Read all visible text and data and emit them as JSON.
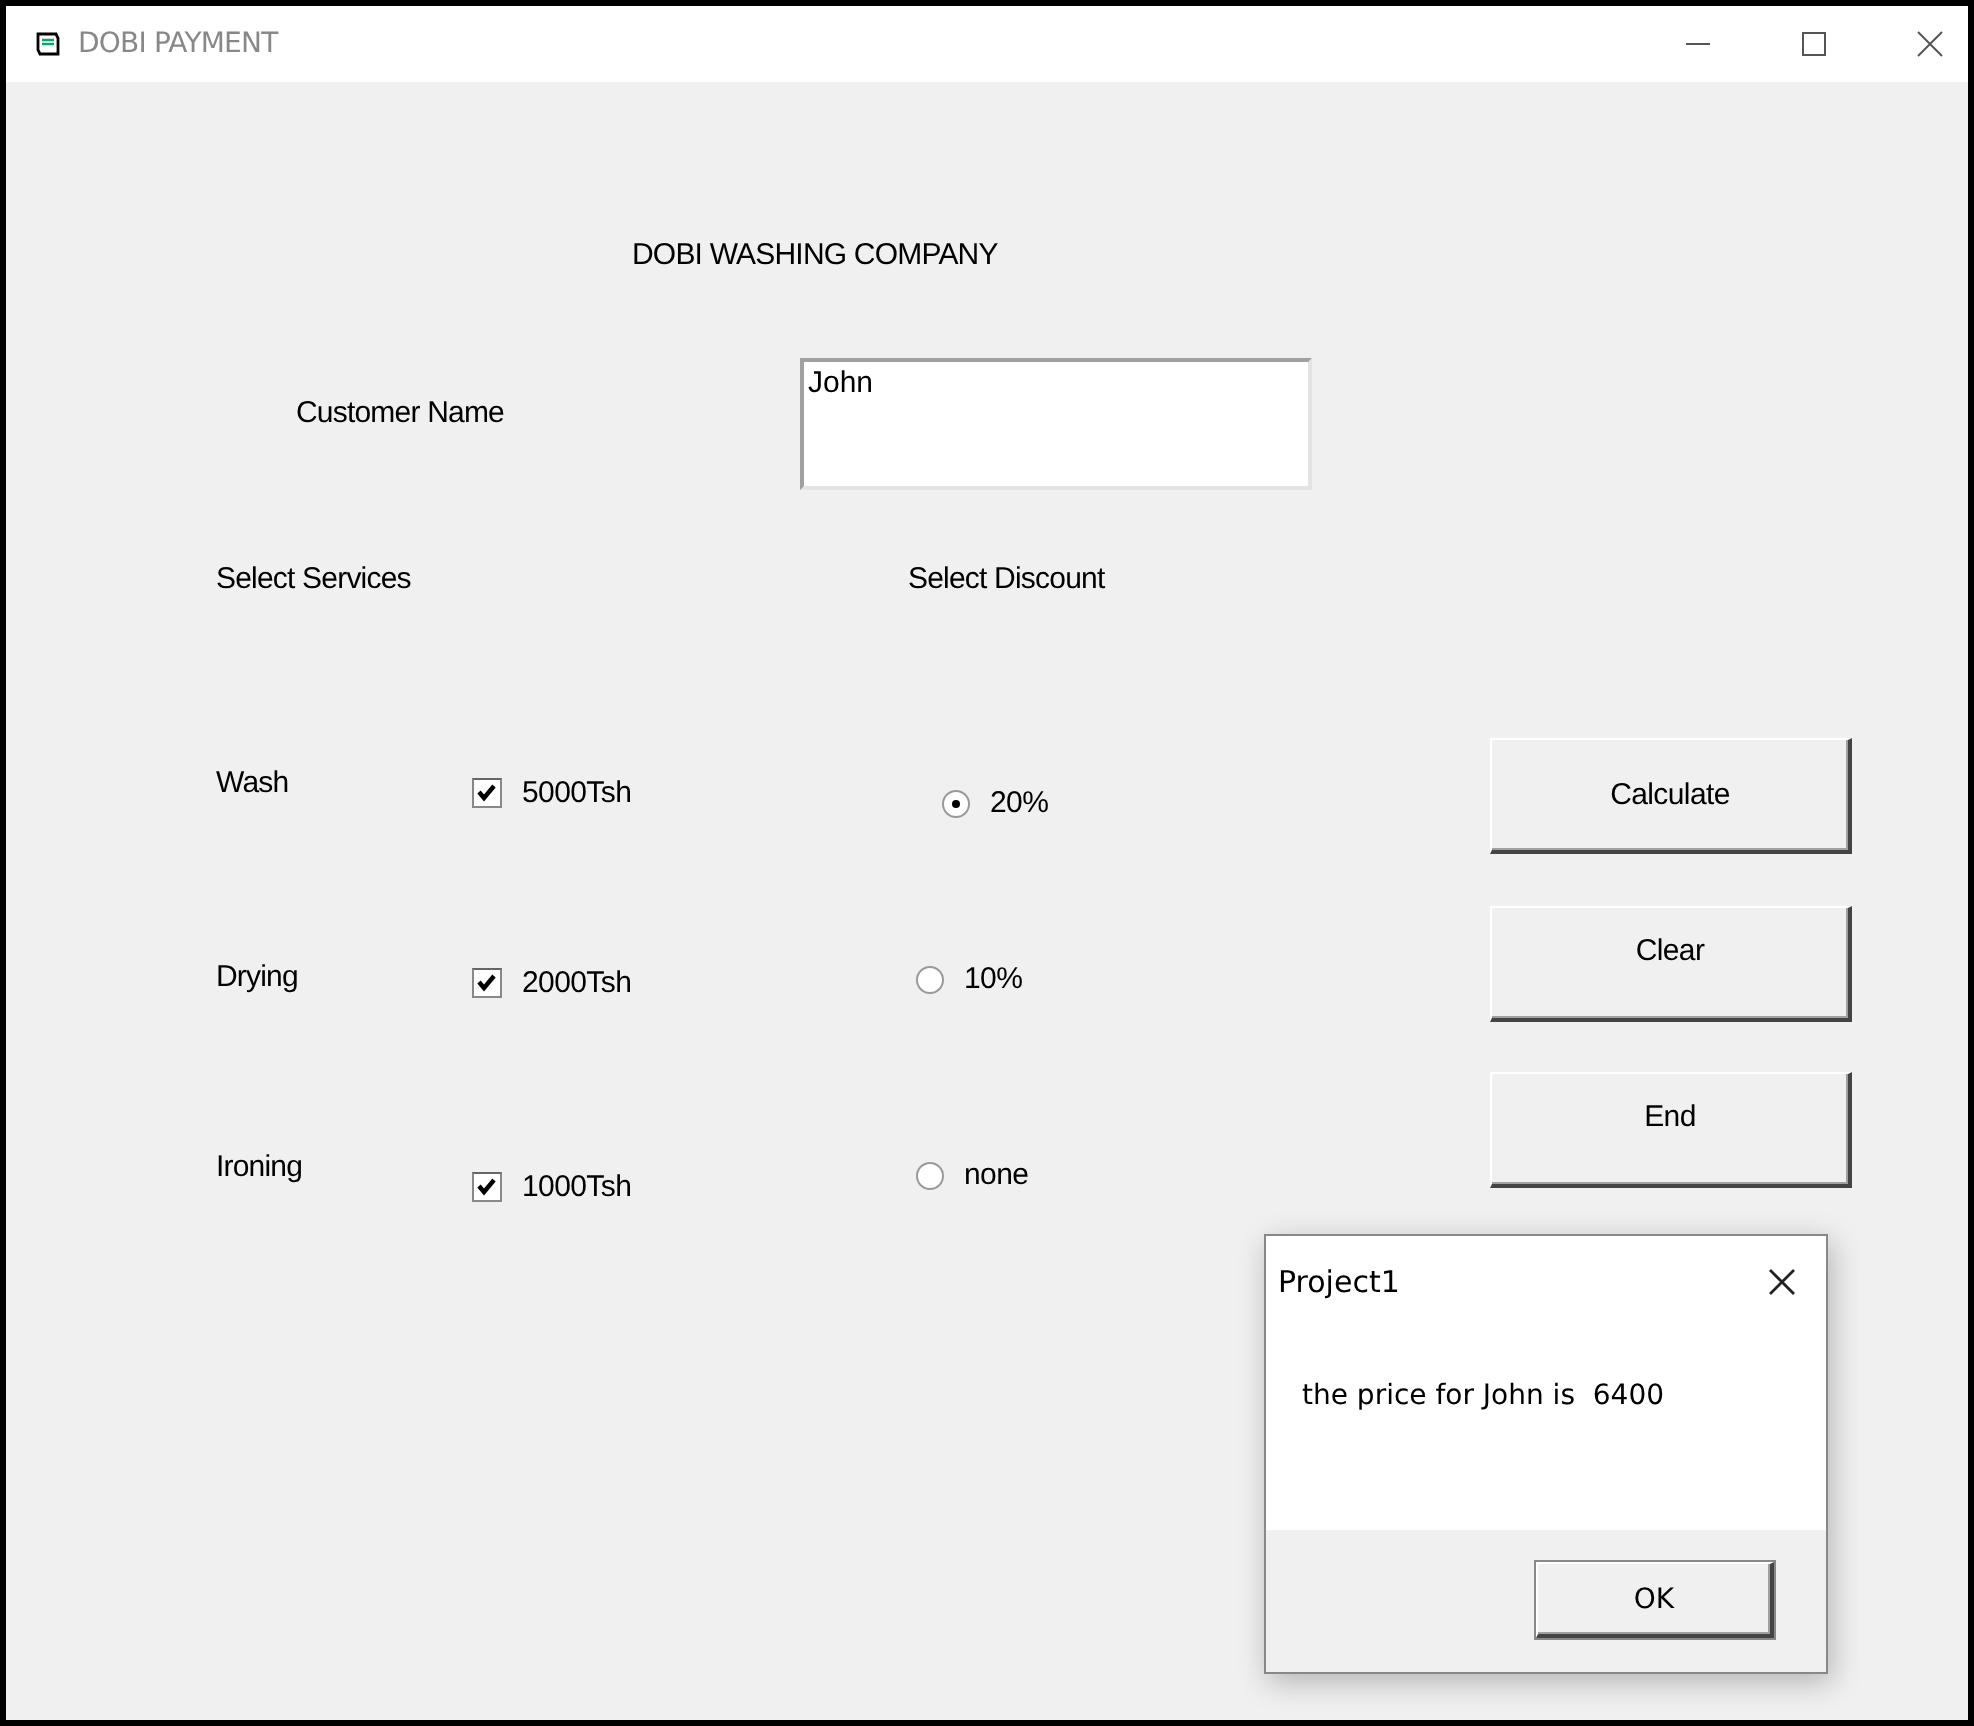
{
  "window": {
    "title": "DOBI PAYMENT"
  },
  "heading": "DOBI WASHING COMPANY",
  "customer": {
    "label": "Customer Name",
    "value": "John"
  },
  "services": {
    "label": "Select Services",
    "items": [
      {
        "name": "Wash",
        "option": "5000Tsh",
        "checked": true
      },
      {
        "name": "Drying",
        "option": "2000Tsh",
        "checked": true
      },
      {
        "name": "Ironing",
        "option": "1000Tsh",
        "checked": true
      }
    ]
  },
  "discount": {
    "label": "Select Discount",
    "options": [
      {
        "label": "20%",
        "selected": true
      },
      {
        "label": "10%",
        "selected": false
      },
      {
        "label": "none",
        "selected": false
      }
    ]
  },
  "buttons": [
    "Calculate",
    "Clear",
    "End"
  ],
  "dialog": {
    "title": "Project1",
    "message": "the price for John is  6400",
    "button": "OK"
  }
}
